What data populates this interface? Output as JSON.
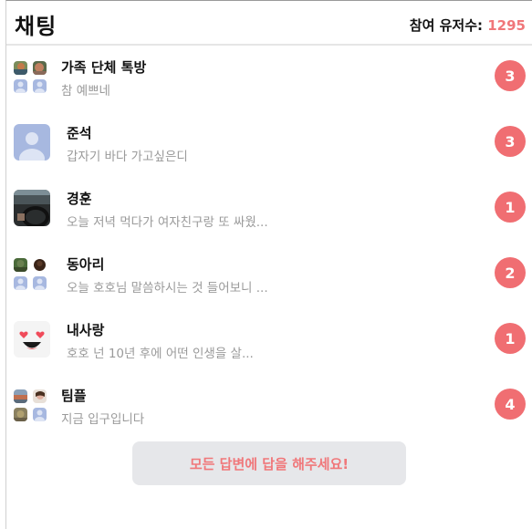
{
  "header": {
    "title": "채팅",
    "user_count_label": "참여 유저수:",
    "user_count_value": "1295"
  },
  "chats": [
    {
      "name": "가족 단체 톡방",
      "preview": "참 예쁘네",
      "unread": "3"
    },
    {
      "name": "준석",
      "preview": "갑자기 바다 가고싶은디",
      "unread": "3"
    },
    {
      "name": "경훈",
      "preview": "오늘 저녁 먹다가 여자친구랑 또 싸웠...",
      "unread": "1"
    },
    {
      "name": "동아리",
      "preview": "오늘 호호님 말씀하시는 것 들어보니 ...",
      "unread": "2"
    },
    {
      "name": "내사랑",
      "preview": "호호 넌 10년 후에 어떤 인생을 살...",
      "unread": "1"
    },
    {
      "name": "팀플",
      "preview": "지금 입구입니다",
      "unread": "4"
    }
  ],
  "answer_button_label": "모든 답변에 답을 해주세요!",
  "colors": {
    "accent": "#f06e72",
    "button_bg": "#e6e7ea",
    "preview_text": "#9a9a9a",
    "default_avatar": "#a7b8e0"
  }
}
